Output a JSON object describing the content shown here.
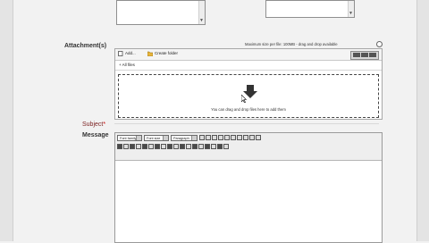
{
  "labels": {
    "attachments": "Attachment(s)",
    "subject": "Subject",
    "subject_required": "*",
    "message": "Message"
  },
  "attachments": {
    "size_hint": "Maximum size per file: 100MB - drag and drop available",
    "add_button": "Add...",
    "create_folder_button": "Create folder",
    "files_heading": "+ All files",
    "drop_text": "You can drag and drop files here to add them"
  },
  "editor": {
    "font_family": "Font family",
    "font_size": "Font size",
    "paragraph": "Paragraph"
  },
  "colors": {
    "subject_label": "#7a1f1f",
    "background": "#f2f2f2"
  },
  "icons": {
    "drop": "down-arrow-icon",
    "cursor": "mouse-pointer-icon",
    "add": "file-add-icon",
    "folder": "folder-icon"
  }
}
